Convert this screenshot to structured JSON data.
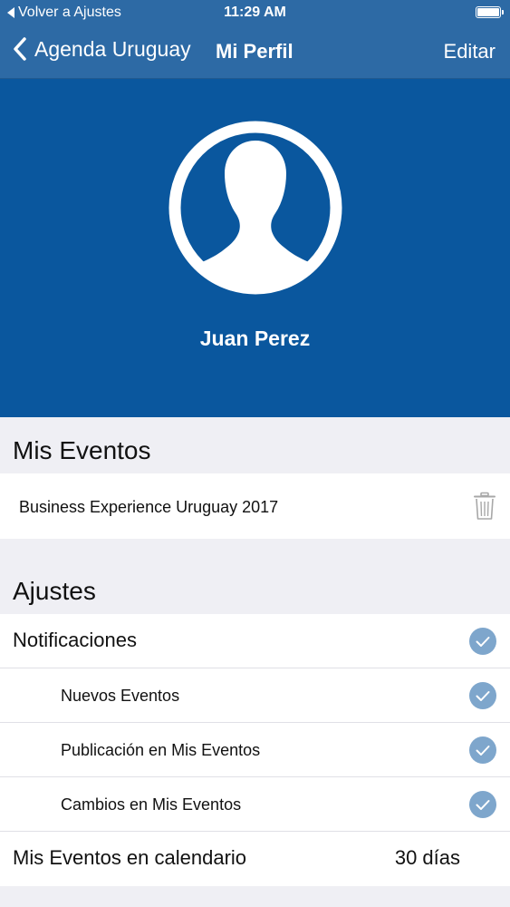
{
  "status_bar": {
    "back_label": "Volver a Ajustes",
    "time": "11:29 AM"
  },
  "nav": {
    "back_label": "Agenda Uruguay",
    "title": "Mi Perfil",
    "edit_label": "Editar"
  },
  "profile": {
    "name": "Juan Perez"
  },
  "mis_eventos": {
    "title": "Mis Eventos",
    "events": [
      {
        "name": "Business Experience Uruguay 2017"
      }
    ]
  },
  "ajustes": {
    "title": "Ajustes",
    "notifications": {
      "label": "Notificaciones",
      "checked": true,
      "items": [
        {
          "label": "Nuevos Eventos",
          "checked": true
        },
        {
          "label": "Publicación en Mis Eventos",
          "checked": true
        },
        {
          "label": "Cambios en Mis Eventos",
          "checked": true
        }
      ]
    },
    "calendar": {
      "label": "Mis Eventos en calendario",
      "value": "30 días"
    }
  },
  "colors": {
    "nav_bar": "#2d6aa5",
    "header": "#0a579e",
    "check": "#7ea6cc",
    "background": "#efeff4"
  }
}
